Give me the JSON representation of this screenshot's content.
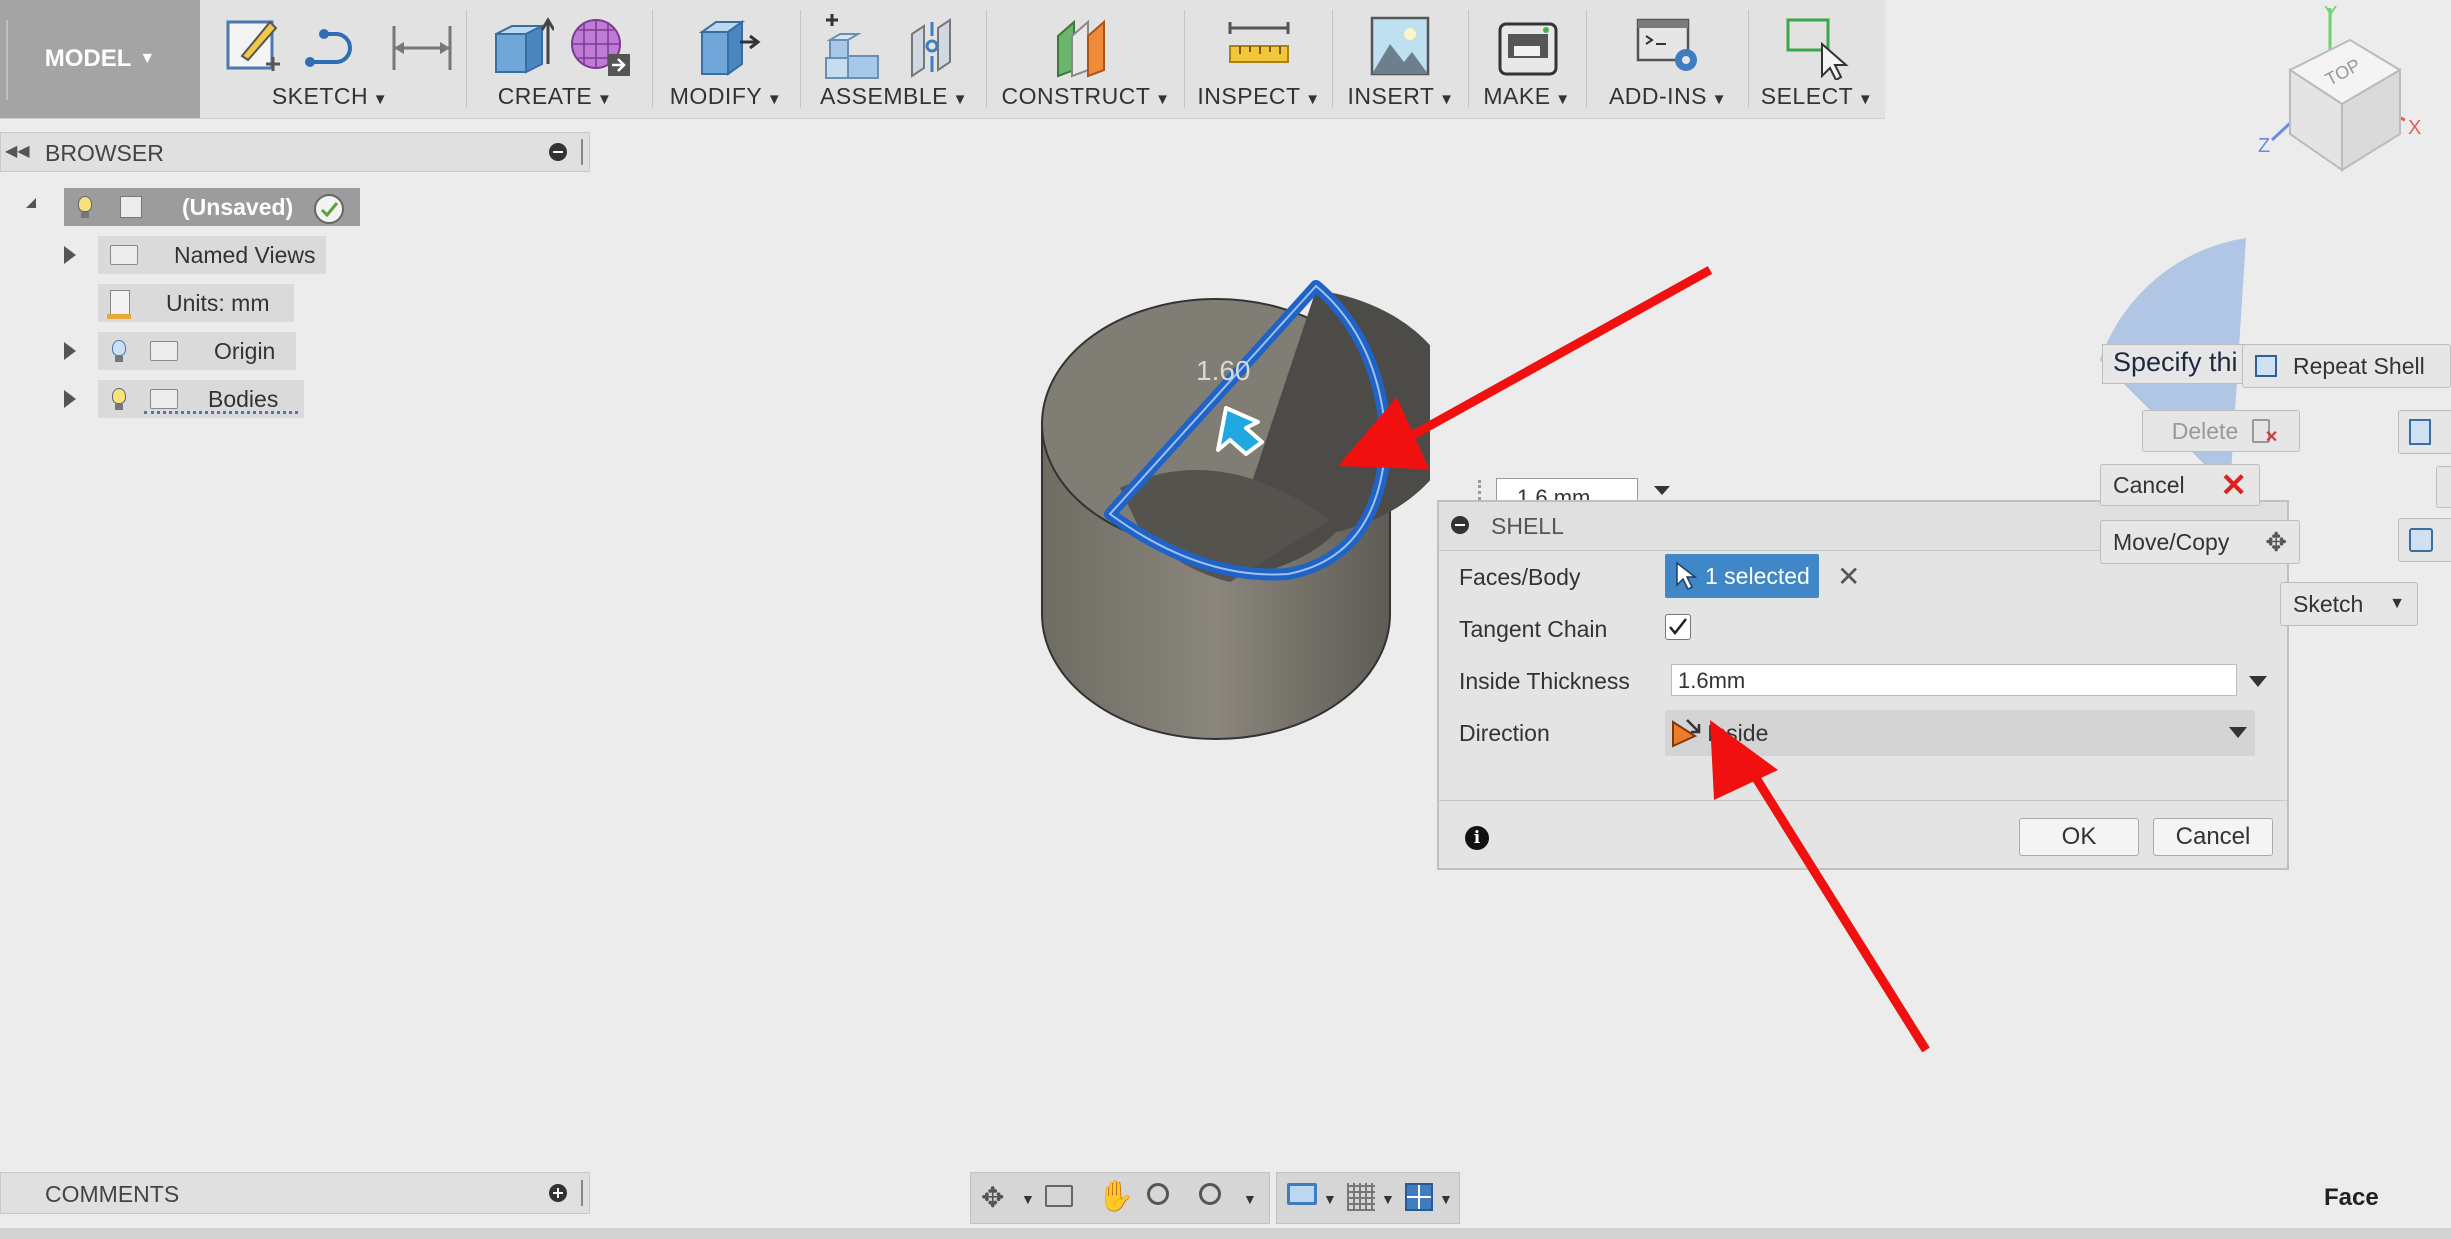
{
  "toolbar": {
    "model_label": "MODEL",
    "groups": [
      {
        "label": "SKETCH"
      },
      {
        "label": "CREATE"
      },
      {
        "label": "MODIFY"
      },
      {
        "label": "ASSEMBLE"
      },
      {
        "label": "CONSTRUCT"
      },
      {
        "label": "INSPECT"
      },
      {
        "label": "INSERT"
      },
      {
        "label": "MAKE"
      },
      {
        "label": "ADD-INS"
      },
      {
        "label": "SELECT"
      }
    ]
  },
  "browser": {
    "title": "BROWSER",
    "root_label": "(Unsaved)",
    "items": [
      {
        "label": "Named Views"
      },
      {
        "label": "Units: mm"
      },
      {
        "label": "Origin"
      },
      {
        "label": "Bodies"
      }
    ]
  },
  "viewcube": {
    "top_label": "TOP",
    "axis_x": "X",
    "axis_y": "Y",
    "axis_z": "Z"
  },
  "viewport": {
    "dimension_label": "1.60",
    "mini_input_value": "1.6 mm"
  },
  "shell_dialog": {
    "title": "SHELL",
    "faces_label": "Faces/Body",
    "faces_value": "1 selected",
    "tangent_label": "Tangent Chain",
    "tangent_checked": true,
    "thickness_label": "Inside Thickness",
    "thickness_value": "1.6mm",
    "direction_label": "Direction",
    "direction_value": "Inside",
    "ok_label": "OK",
    "cancel_label": "Cancel"
  },
  "marking_menu": {
    "specify_text": "Specify thi",
    "repeat_label": "Repeat Shell",
    "delete_label": "Delete",
    "cancel_label": "Cancel",
    "move_copy_label": "Move/Copy",
    "sketch_label": "Sketch"
  },
  "comments": {
    "title": "COMMENTS"
  },
  "status": {
    "selection_filter": "Face"
  },
  "colors": {
    "accent_blue": "#3f87c6",
    "arrow_red": "#f01010",
    "selection_blue": "#1f63c7"
  }
}
